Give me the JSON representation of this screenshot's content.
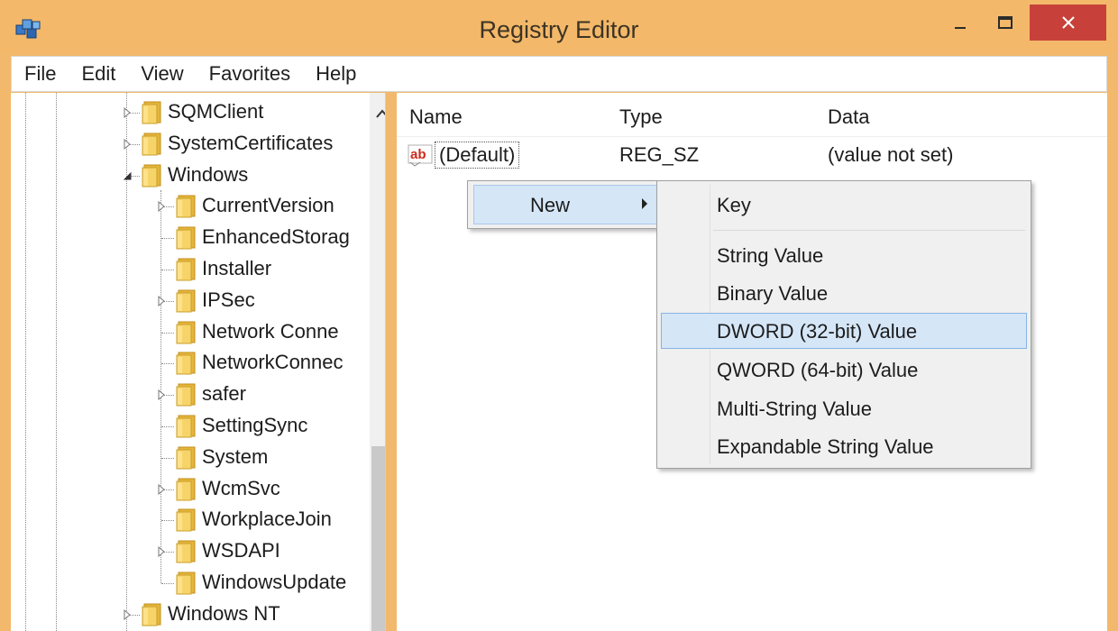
{
  "window": {
    "title": "Registry Editor",
    "close_glyph": "✕",
    "min_glyph": "—",
    "max_glyph": "☐"
  },
  "menubar": [
    "File",
    "Edit",
    "View",
    "Favorites",
    "Help"
  ],
  "tree": {
    "items": [
      {
        "label": "SQMClient",
        "expander": "right"
      },
      {
        "label": "SystemCertificates",
        "expander": "right"
      },
      {
        "label": "Windows",
        "expander": "down"
      },
      {
        "label": "CurrentVersion",
        "expander": "right"
      },
      {
        "label": "EnhancedStorag",
        "expander": "none"
      },
      {
        "label": "Installer",
        "expander": "none"
      },
      {
        "label": "IPSec",
        "expander": "right"
      },
      {
        "label": "Network Conne",
        "expander": "none"
      },
      {
        "label": "NetworkConnec",
        "expander": "none"
      },
      {
        "label": "safer",
        "expander": "right"
      },
      {
        "label": "SettingSync",
        "expander": "none"
      },
      {
        "label": "System",
        "expander": "none"
      },
      {
        "label": "WcmSvc",
        "expander": "right"
      },
      {
        "label": "WorkplaceJoin",
        "expander": "none"
      },
      {
        "label": "WSDAPI",
        "expander": "right"
      },
      {
        "label": "WindowsUpdate",
        "expander": "none"
      },
      {
        "label": "Windows NT",
        "expander": "right"
      }
    ]
  },
  "list": {
    "columns": [
      "Name",
      "Type",
      "Data"
    ],
    "rows": [
      {
        "icon": "ab",
        "name": "(Default)",
        "type": "REG_SZ",
        "data": "(value not set)"
      }
    ]
  },
  "context_menu": {
    "new_label": "New"
  },
  "submenu": {
    "items": [
      "Key",
      "String Value",
      "Binary Value",
      "DWORD (32-bit) Value",
      "QWORD (64-bit) Value",
      "Multi-String Value",
      "Expandable String Value"
    ],
    "highlighted": "DWORD (32-bit) Value"
  },
  "colors": {
    "titlebar": "#f3b86a",
    "close_button": "#c7413a",
    "highlight": "#d5e6f7",
    "folder": "#f2c744"
  }
}
